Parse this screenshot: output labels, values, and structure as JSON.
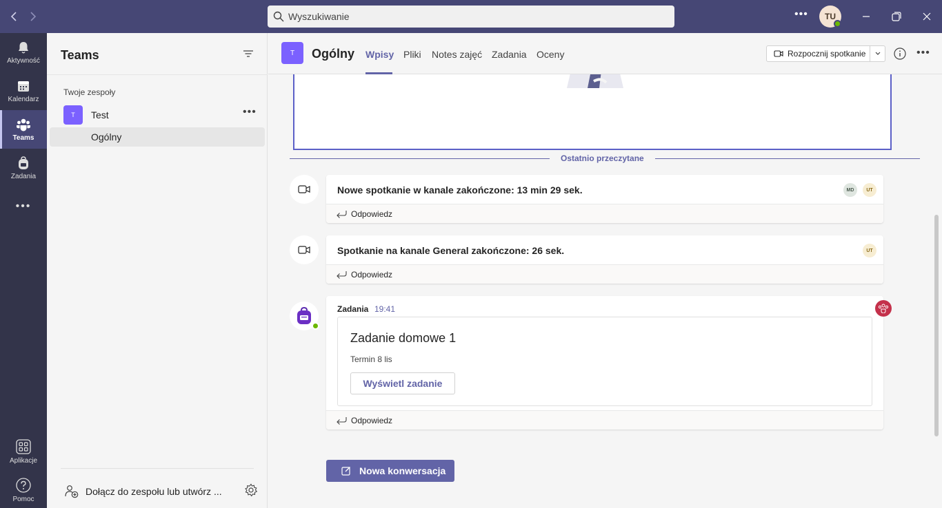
{
  "titlebar": {
    "search_placeholder": "Wyszukiwanie",
    "user_initials": "TU",
    "colors": {
      "bg": "#464775",
      "presence": "#6bb700"
    }
  },
  "rail": {
    "items": [
      {
        "label": "Aktywność",
        "icon": "bell-icon"
      },
      {
        "label": "Kalendarz",
        "icon": "calendar-icon"
      },
      {
        "label": "Teams",
        "icon": "teams-icon",
        "active": true
      },
      {
        "label": "Zadania",
        "icon": "backpack-icon"
      },
      {
        "label": "...",
        "icon": "more-icon"
      }
    ],
    "bottom": [
      {
        "label": "Aplikacje",
        "icon": "apps-icon"
      },
      {
        "label": "Pomoc",
        "icon": "help-icon"
      }
    ]
  },
  "panel": {
    "title": "Teams",
    "section": "Twoje zespoły",
    "team": {
      "initial": "T",
      "name": "Test"
    },
    "channel": "Ogólny",
    "join_label": "Dołącz do zespołu lub utwórz ..."
  },
  "header": {
    "initial": "T",
    "title": "Ogólny",
    "tabs": [
      "Wpisy",
      "Pliki",
      "Notes zajęć",
      "Zadania",
      "Oceny"
    ],
    "active_tab": "Wpisy",
    "meet_label": "Rozpocznij spotkanie",
    "accent": "#6264a7"
  },
  "feed": {
    "last_read": "Ostatnio przeczytane",
    "messages": [
      {
        "text": "Nowe spotkanie w kanale zakończone: 13 min 29 sek.",
        "participants": [
          "MD",
          "UT"
        ],
        "reply": "Odpowiedz"
      },
      {
        "text": "Spotkanie na kanale General zakończone: 26 sek.",
        "participants": [
          "UT"
        ],
        "reply": "Odpowiedz"
      }
    ],
    "assignment": {
      "sender": "Zadania",
      "time": "19:41",
      "title": "Zadanie domowe 1",
      "due": "Termin 8 lis",
      "button": "Wyświetl zadanie",
      "reply": "Odpowiedz"
    },
    "new_conversation": "Nowa konwersacja"
  }
}
